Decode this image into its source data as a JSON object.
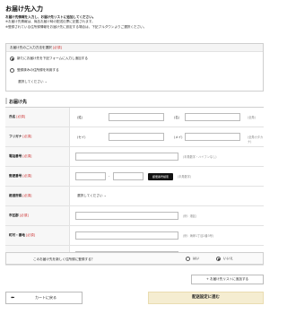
{
  "page": {
    "title": "お届け先入力",
    "intro": [
      "お届け先情報を入力し、お届け先リストに追加してください。",
      "※お届け先情報は、商品お届け時の配送伝票に記載されます。",
      "※登録されている住所録情報をお届け先に設定する場合は、下記プルダウンよりご選択ください。"
    ]
  },
  "select_box": {
    "heading": "お届け先のご入力方法を選択",
    "required": "[必須]",
    "option_new": "新たにお届け先を下記フォームに入力し追加する",
    "option_existing": "登録済みの住所録を利用する",
    "dropdown": "選択してください"
  },
  "section": {
    "title": "お届け先"
  },
  "form": {
    "name": {
      "label": "氏名",
      "required": "[必須]",
      "sei": "(姓)",
      "mei": "(名)",
      "hint": "(全角)"
    },
    "furigana": {
      "label": "フリガナ",
      "required": "[必須]",
      "sei": "(セイ)",
      "mei": "(メイ)",
      "hint": "(全角カタカナ)"
    },
    "phone": {
      "label": "電話番号",
      "required": "[必須]",
      "hint": "(半角数字・ハイフンなし)"
    },
    "zip": {
      "label": "郵便番号",
      "required": "[必須]",
      "dash": "-",
      "button": "郵便番号検索",
      "hint": "(半角数字)"
    },
    "pref": {
      "label": "都道府県",
      "required": "[必須]",
      "dropdown": "選択してください"
    },
    "city": {
      "label": "市区郡",
      "required": "[必須]",
      "hint": "(例：港区)"
    },
    "town": {
      "label": "町村・番地",
      "required": "[必須]",
      "hint": "(例：海岸1丁目2番3号)"
    },
    "building": {
      "label": "マンション・建物名",
      "hint": "(例：東京ビル5階)"
    }
  },
  "save": {
    "question": "このお届け先を新しく住所録に登録する？",
    "yes": "はい",
    "no": "いいえ",
    "selected": "いいえ"
  },
  "buttons": {
    "add": "+ お届け先リストに追加する",
    "back": "カートに戻る",
    "back_arrow": "⬅",
    "next": "配送設定に進む"
  }
}
